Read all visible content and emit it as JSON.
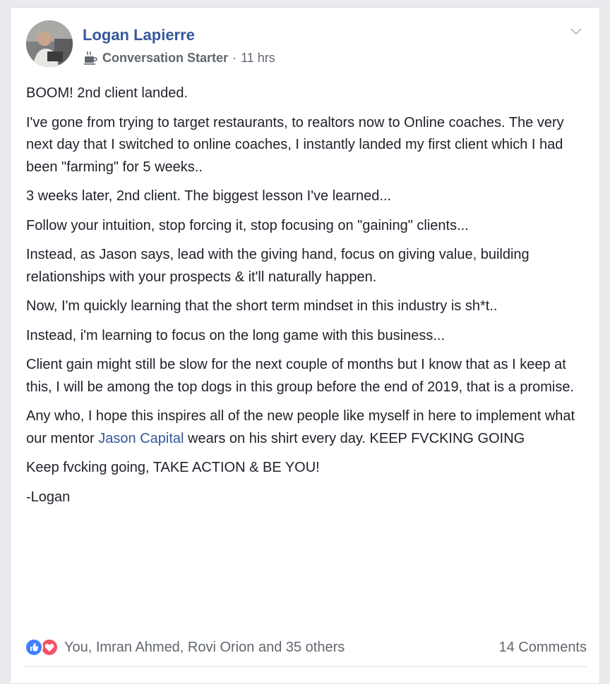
{
  "post": {
    "author": "Logan Lapierre",
    "badge_icon": "coffee-cup-icon",
    "badge_label": "Conversation Starter",
    "separator": "·",
    "time": "11 hrs",
    "paragraphs": [
      {
        "text": "BOOM! 2nd client landed."
      },
      {
        "text": "I've gone from trying to target restaurants, to realtors now to Online coaches. The very next day that I switched to online coaches, I instantly landed my first client which I had been \"farming\" for 5 weeks.."
      },
      {
        "text": "3 weeks later, 2nd client. The biggest lesson I've learned..."
      },
      {
        "text": "Follow your intuition, stop forcing it, stop focusing on \"gaining\" clients..."
      },
      {
        "text": "Instead, as Jason says, lead with the giving hand, focus on giving value, building relationships with your prospects & it'll naturally happen."
      },
      {
        "text": "Now, I'm quickly learning that the short term mindset in this industry is sh*t.."
      },
      {
        "text": "Instead, i'm learning to focus on the long game with this business..."
      },
      {
        "text": "Client gain might still be slow for the next couple of months but I know that as I keep at this, I will be among the top dogs in this group before the end of 2019, that is a promise."
      },
      {
        "before": "Any who, I hope this inspires all of the new people like myself in here to implement what our mentor ",
        "mention": "Jason Capital",
        "after": " wears on his shirt every day. KEEP FVCKING GOING"
      },
      {
        "text": "Keep fvcking going, TAKE ACTION & BE YOU!"
      },
      {
        "text": "-Logan"
      }
    ]
  },
  "footer": {
    "reaction_icons": [
      "like-icon",
      "love-icon"
    ],
    "reactions_text": "You, Imran Ahmed, Rovi Orion and 35 others",
    "comments_text": "14 Comments"
  },
  "colors": {
    "link": "#365899",
    "text": "#1d2129",
    "meta": "#606770",
    "like": "#4080ff",
    "love": "#f25268"
  }
}
